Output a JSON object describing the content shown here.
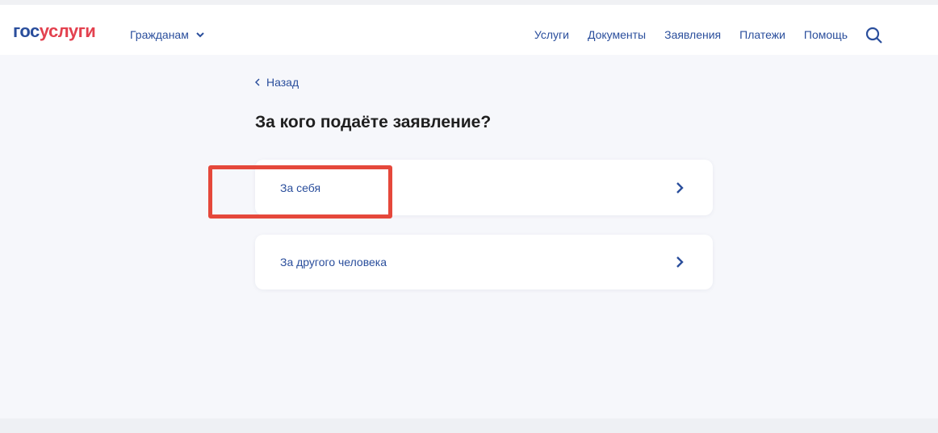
{
  "header": {
    "logo": {
      "part1": "гос",
      "part2": "услуги"
    },
    "audience": "Гражданам",
    "nav": [
      "Услуги",
      "Документы",
      "Заявления",
      "Платежи",
      "Помощь"
    ]
  },
  "back_label": "Назад",
  "title": "За кого подаёте заявление?",
  "options": [
    {
      "label": "За себя",
      "highlighted": true
    },
    {
      "label": "За другого человека",
      "highlighted": false
    }
  ],
  "colors": {
    "accent": "#2a4e9c",
    "logo_red": "#e3414f",
    "highlight": "#e5483b"
  }
}
